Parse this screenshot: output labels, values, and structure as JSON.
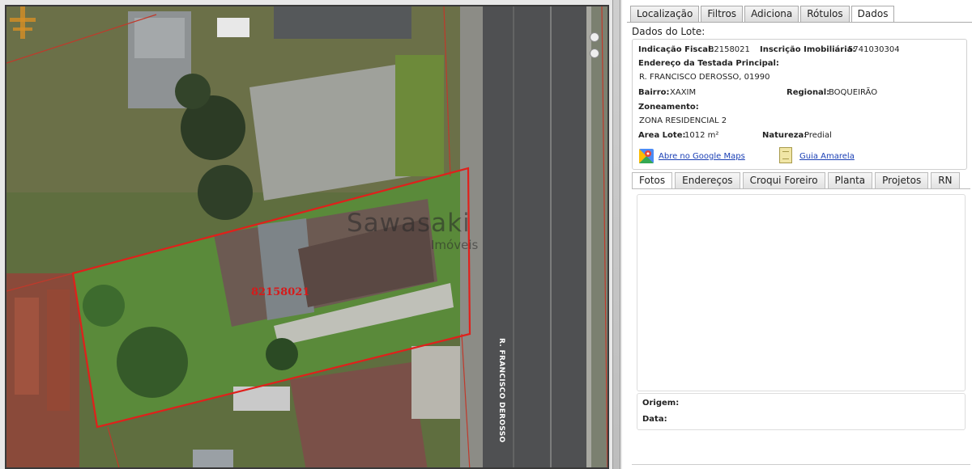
{
  "map": {
    "lot_code": "82158021",
    "street_label": "R. FRANCISCO DEROSSO",
    "watermark_name": "Sawasaki",
    "watermark_sub": "Imóveis"
  },
  "tabs": [
    "Localização",
    "Filtros",
    "Adiciona",
    "Rótulos",
    "Dados"
  ],
  "active_tab": "Dados",
  "lote": {
    "section_title": "Dados do Lote:",
    "indicacao_label": "Indicação Fiscal:",
    "indicacao_value": "82158021",
    "inscricao_label": "Inscrição Imobiliária:",
    "inscricao_value": "5741030304",
    "endereco_label": "Endereço da Testada Principal:",
    "endereco_value": "R. FRANCISCO DEROSSO, 01990",
    "bairro_label": "Bairro:",
    "bairro_value": "XAXIM",
    "regional_label": "Regional:",
    "regional_value": "BOQUEIRÃO",
    "zoneamento_label": "Zoneamento:",
    "zoneamento_value": "ZONA RESIDENCIAL 2",
    "area_label": "Area Lote:",
    "area_value": "1012 m²",
    "natureza_label": "Natureza:",
    "natureza_value": "Predial",
    "maps_link": "Abre no Google Maps",
    "guia_link": "Guia Amarela"
  },
  "subtabs": [
    "Fotos",
    "Endereços",
    "Croqui Foreiro",
    "Planta",
    "Projetos",
    "RN"
  ],
  "active_subtab": "Fotos",
  "meta": {
    "origem_label": "Origem:",
    "data_label": "Data:"
  },
  "colors": {
    "lot_outline": "#e0201b",
    "lot_code": "#d61a1a",
    "link": "#1a3fb5"
  }
}
